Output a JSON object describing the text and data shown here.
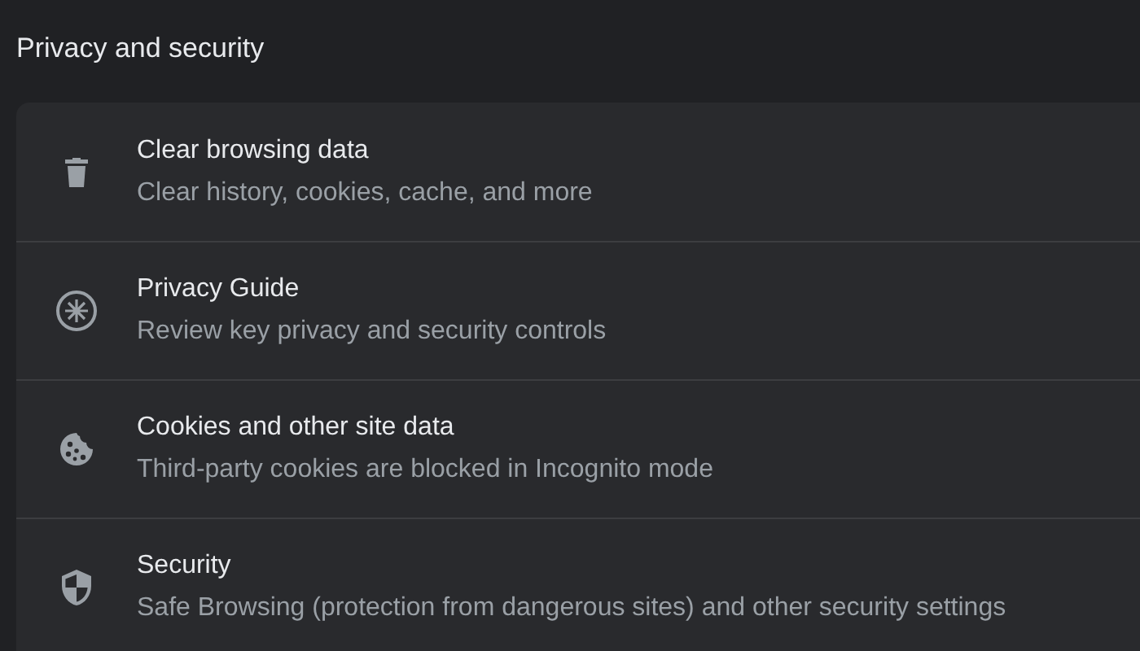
{
  "section_title": "Privacy and security",
  "items": [
    {
      "title": "Clear browsing data",
      "subtitle": "Clear history, cookies, cache, and more"
    },
    {
      "title": "Privacy Guide",
      "subtitle": "Review key privacy and security controls"
    },
    {
      "title": "Cookies and other site data",
      "subtitle": "Third-party cookies are blocked in Incognito mode"
    },
    {
      "title": "Security",
      "subtitle": "Safe Browsing (protection from dangerous sites) and other security settings"
    }
  ]
}
